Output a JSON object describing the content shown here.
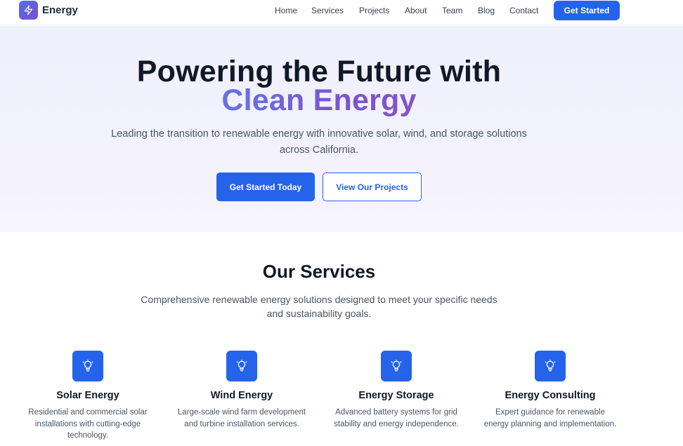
{
  "brand": {
    "name": "Energy",
    "logo_icon": "lightning-bolt-icon",
    "accent": "#2563eb"
  },
  "nav": {
    "links": [
      "Home",
      "Services",
      "Projects",
      "About",
      "Team",
      "Blog",
      "Contact"
    ],
    "cta_label": "Get Started"
  },
  "hero": {
    "title_line1": "Powering the Future with",
    "title_line2": "Clean Energy",
    "subtitle": "Leading the transition to renewable energy with innovative solar, wind, and storage solutions across California.",
    "primary_button": "Get Started Today",
    "secondary_button": "View Our Projects"
  },
  "services": {
    "title": "Our Services",
    "subtitle": "Comprehensive renewable energy solutions designed to meet your specific needs and sustainability goals.",
    "items": [
      {
        "title": "Solar Energy",
        "description": "Residential and commercial solar installations with cutting-edge technology.",
        "icon": "lightbulb-icon"
      },
      {
        "title": "Wind Energy",
        "description": "Large-scale wind farm development and turbine installation services.",
        "icon": "lightbulb-icon"
      },
      {
        "title": "Energy Storage",
        "description": "Advanced battery systems for grid stability and energy independence.",
        "icon": "lightbulb-icon"
      },
      {
        "title": "Energy Consulting",
        "description": "Expert guidance for renewable energy planning and implementation.",
        "icon": "lightbulb-icon"
      }
    ]
  }
}
